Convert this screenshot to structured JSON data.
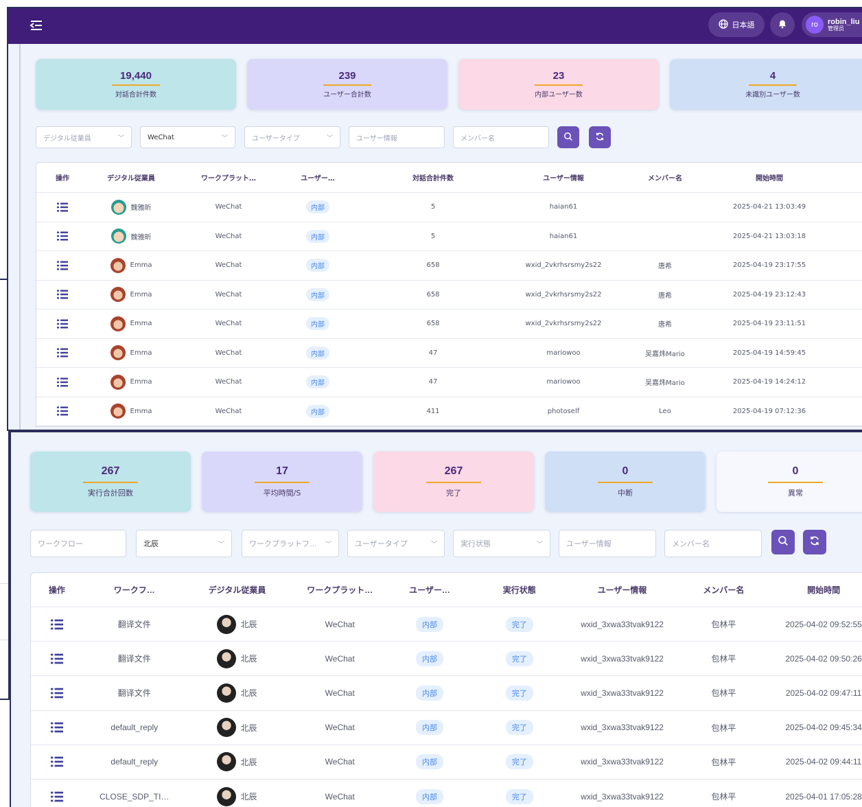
{
  "topbar": {
    "language_label": "日本語",
    "user_avatar_initials": "ro",
    "user_name": "robin_liu",
    "user_role": "管理员"
  },
  "panel1": {
    "stats": [
      {
        "value": "19,440",
        "label": "対話合計件数",
        "color": "#bde5ea"
      },
      {
        "value": "239",
        "label": "ユーザー合計数",
        "color": "#d9d8fb"
      },
      {
        "value": "23",
        "label": "内部ユーザー数",
        "color": "#fbd9e6"
      },
      {
        "value": "4",
        "label": "未識別ユーザー数",
        "color": "#cfdff6"
      }
    ],
    "filters": {
      "digital_employee_placeholder": "デジタル従業員",
      "platform_value": "WeChat",
      "user_type_placeholder": "ユーザータイプ",
      "user_info_placeholder": "ユーザー情報",
      "member_name_placeholder": "メンバー名"
    },
    "columns": [
      "操作",
      "デジタル従業員",
      "ワークプラット…",
      "ユーザー…",
      "対話合計件数",
      "ユーザー情報",
      "メンバー名",
      "開始時間"
    ],
    "rows": [
      {
        "employee": "魏雅昕",
        "avatar": "green",
        "platform": "WeChat",
        "user_type": "内部",
        "count": "5",
        "user_info": "haian61",
        "member": "",
        "start": "2025-04-21 13:03:49"
      },
      {
        "employee": "魏雅昕",
        "avatar": "green",
        "platform": "WeChat",
        "user_type": "内部",
        "count": "5",
        "user_info": "haian61",
        "member": "",
        "start": "2025-04-21 13:03:18"
      },
      {
        "employee": "Emma",
        "avatar": "red",
        "platform": "WeChat",
        "user_type": "内部",
        "count": "658",
        "user_info": "wxid_2vkrhsrsmy2s22",
        "member": "唐希",
        "start": "2025-04-19 23:17:55"
      },
      {
        "employee": "Emma",
        "avatar": "red",
        "platform": "WeChat",
        "user_type": "内部",
        "count": "658",
        "user_info": "wxid_2vkrhsrsmy2s22",
        "member": "唐希",
        "start": "2025-04-19 23:12:43"
      },
      {
        "employee": "Emma",
        "avatar": "red",
        "platform": "WeChat",
        "user_type": "内部",
        "count": "658",
        "user_info": "wxid_2vkrhsrsmy2s22",
        "member": "唐希",
        "start": "2025-04-19 23:11:51"
      },
      {
        "employee": "Emma",
        "avatar": "red",
        "platform": "WeChat",
        "user_type": "内部",
        "count": "47",
        "user_info": "mariowoo",
        "member": "吴嘉炜Mario",
        "start": "2025-04-19 14:59:45"
      },
      {
        "employee": "Emma",
        "avatar": "red",
        "platform": "WeChat",
        "user_type": "内部",
        "count": "47",
        "user_info": "mariowoo",
        "member": "吴嘉炜Mario",
        "start": "2025-04-19 14:24:12"
      },
      {
        "employee": "Emma",
        "avatar": "red",
        "platform": "WeChat",
        "user_type": "内部",
        "count": "411",
        "user_info": "photoself",
        "member": "Leo",
        "start": "2025-04-19 07:12:36"
      }
    ]
  },
  "panel2": {
    "stats": [
      {
        "value": "267",
        "label": "実行合計回数",
        "color": "#bde5ea"
      },
      {
        "value": "17",
        "label": "平均時間/S",
        "color": "#d9d8fb"
      },
      {
        "value": "267",
        "label": "完了",
        "color": "#fbd9e6"
      },
      {
        "value": "0",
        "label": "中断",
        "color": "#cfdff6"
      },
      {
        "value": "0",
        "label": "異常",
        "color": "#f6f8fd"
      }
    ],
    "filters": {
      "workflow_placeholder": "ワークフロー",
      "employee_value": "北辰",
      "platform_placeholder": "ワークプラットフ…",
      "user_type_placeholder": "ユーザータイプ",
      "status_placeholder": "実行状態",
      "user_info_placeholder": "ユーザー情報",
      "member_name_placeholder": "メンバー名"
    },
    "columns": [
      "操作",
      "ワークフ…",
      "デジタル従業員",
      "ワークプラット…",
      "ユーザー…",
      "実行状態",
      "ユーザー情報",
      "メンバー名",
      "開始時間"
    ],
    "rows": [
      {
        "workflow": "翻译文件",
        "employee": "北辰",
        "platform": "WeChat",
        "user_type": "内部",
        "status": "完了",
        "user_info": "wxid_3xwa33tvak9122",
        "member": "包林平",
        "start": "2025-04-02 09:52:55"
      },
      {
        "workflow": "翻译文件",
        "employee": "北辰",
        "platform": "WeChat",
        "user_type": "内部",
        "status": "完了",
        "user_info": "wxid_3xwa33tvak9122",
        "member": "包林平",
        "start": "2025-04-02 09:50:26"
      },
      {
        "workflow": "翻译文件",
        "employee": "北辰",
        "platform": "WeChat",
        "user_type": "内部",
        "status": "完了",
        "user_info": "wxid_3xwa33tvak9122",
        "member": "包林平",
        "start": "2025-04-02 09:47:11"
      },
      {
        "workflow": "default_reply",
        "employee": "北辰",
        "platform": "WeChat",
        "user_type": "内部",
        "status": "完了",
        "user_info": "wxid_3xwa33tvak9122",
        "member": "包林平",
        "start": "2025-04-02 09:45:34"
      },
      {
        "workflow": "default_reply",
        "employee": "北辰",
        "platform": "WeChat",
        "user_type": "内部",
        "status": "完了",
        "user_info": "wxid_3xwa33tvak9122",
        "member": "包林平",
        "start": "2025-04-02 09:44:11"
      },
      {
        "workflow": "CLOSE_SDP_TI…",
        "employee": "北辰",
        "platform": "WeChat",
        "user_type": "内部",
        "status": "完了",
        "user_info": "wxid_3xwa33tvak9122",
        "member": "包林平",
        "start": "2025-04-01 17:05:28"
      }
    ]
  }
}
